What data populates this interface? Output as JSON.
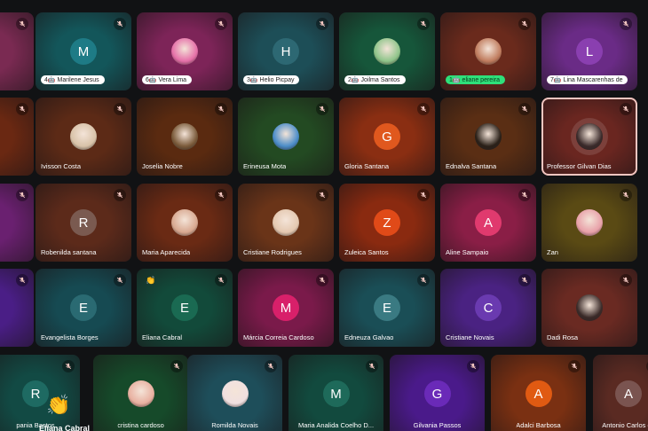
{
  "meeting": {
    "tiles": [
      {
        "name": "",
        "row": 0,
        "col": -1,
        "bg": "#7a2a52",
        "avatar": "none",
        "mic": "muted"
      },
      {
        "name": "",
        "pill": "4🤖 Marilene Jesus",
        "row": 0,
        "col": 0,
        "bg": "#13565a",
        "avatar": "M",
        "avatarColor": "#1e7b86",
        "mic": "muted"
      },
      {
        "name": "",
        "pill": "6🤖 Vera Lima",
        "row": 0,
        "col": 1,
        "bg": "#7d2458",
        "avatar": "photo",
        "avatarColor": "#e56fa8",
        "mic": "muted"
      },
      {
        "name": "",
        "pill": "3🤖 Helio Picpay",
        "row": 0,
        "col": 2,
        "bg": "#1d4e57",
        "avatar": "H",
        "avatarColor": "#2d6873",
        "mic": "muted"
      },
      {
        "name": "",
        "pill": "2🤖 Joilma Santos",
        "row": 0,
        "col": 3,
        "bg": "#16563a",
        "avatar": "photo",
        "avatarColor": "#8fc48a",
        "mic": "muted"
      },
      {
        "name": "",
        "pill": "1🤖 eliane pereira",
        "pillGreen": true,
        "row": 0,
        "col": 4,
        "bg": "#6a2a1c",
        "avatar": "photo",
        "avatarColor": "#c07c5e",
        "mic": "muted"
      },
      {
        "name": "",
        "pill": "7🤖 Lina Mascarenhas de",
        "row": 0,
        "col": 5,
        "bg": "#6a2b86",
        "avatar": "L",
        "avatarColor": "#8a3fb0",
        "mic": "muted"
      },
      {
        "name": "",
        "row": 1,
        "col": -1,
        "bg": "#6a2812",
        "avatar": "none",
        "mic": "muted"
      },
      {
        "name": "Ivisson Costa",
        "row": 1,
        "col": 0,
        "bg": "#5c2a16",
        "avatar": "photo",
        "avatarColor": "#d8c2a8",
        "mic": "muted"
      },
      {
        "name": "Joselia Nobre",
        "row": 1,
        "col": 1,
        "bg": "#5a2a10",
        "avatar": "photo",
        "avatarColor": "#7a5a3a",
        "mic": "muted"
      },
      {
        "name": "Erineusa Mota",
        "row": 1,
        "col": 2,
        "bg": "#234a22",
        "avatar": "photo",
        "avatarColor": "#4a8cc8",
        "mic": "muted"
      },
      {
        "name": "Gloria Santana",
        "row": 1,
        "col": 3,
        "bg": "#8a2e12",
        "avatar": "G",
        "avatarColor": "#e0581e",
        "mic": "muted"
      },
      {
        "name": "Ednalva Santana",
        "row": 1,
        "col": 4,
        "bg": "#5a2e14",
        "avatar": "photo",
        "avatarColor": "#2a2018",
        "mic": "muted"
      },
      {
        "name": "Professor Gilvan Dias",
        "row": 1,
        "col": 5,
        "bg": "#6a2620",
        "avatar": "photo",
        "avatarColor": "#3a2a2a",
        "mic": "muted",
        "active": true
      },
      {
        "name": "",
        "row": 2,
        "col": -1,
        "bg": "#6a2070",
        "avatar": "none",
        "mic": "muted"
      },
      {
        "name": "Robenilda santana",
        "row": 2,
        "col": 0,
        "bg": "#5c2a1a",
        "avatar": "R",
        "avatarColor": "#7a5a50",
        "mic": "muted"
      },
      {
        "name": "Maria Aparecida",
        "row": 2,
        "col": 1,
        "bg": "#6a2a14",
        "avatar": "photo",
        "avatarColor": "#d8a890",
        "mic": "muted"
      },
      {
        "name": "Cristiane Rodrigues",
        "row": 2,
        "col": 2,
        "bg": "#6a3418",
        "avatar": "photo",
        "avatarColor": "#e4c8b0",
        "mic": "muted"
      },
      {
        "name": "Zuleica Santos",
        "row": 2,
        "col": 3,
        "bg": "#8a2a10",
        "avatar": "Z",
        "avatarColor": "#e04a18",
        "mic": "muted"
      },
      {
        "name": "Aline Sampaio",
        "row": 2,
        "col": 4,
        "bg": "#8a1e46",
        "avatar": "A",
        "avatarColor": "#e03a6e",
        "mic": "muted"
      },
      {
        "name": "Zan",
        "row": 2,
        "col": 5,
        "bg": "#5a4a14",
        "avatar": "photo",
        "avatarColor": "#e8a0a8",
        "mic": "muted"
      },
      {
        "name": "",
        "row": 3,
        "col": -1,
        "bg": "#4a1e86",
        "avatar": "none",
        "mic": "muted"
      },
      {
        "name": "Evangelista Borges",
        "row": 3,
        "col": 0,
        "bg": "#164a52",
        "avatar": "E",
        "avatarColor": "#2a6a72",
        "mic": "muted"
      },
      {
        "name": "Eliana Cabral",
        "row": 3,
        "col": 1,
        "bg": "#124a3a",
        "avatar": "E",
        "avatarColor": "#1a6a52",
        "mic": "muted",
        "hand": true
      },
      {
        "name": "Márcia Correia Cardoso",
        "row": 3,
        "col": 2,
        "bg": "#7a1a4a",
        "avatar": "M",
        "avatarColor": "#d8206a",
        "mic": "muted"
      },
      {
        "name": "Edneuza Galvao",
        "row": 3,
        "col": 3,
        "bg": "#1a4e56",
        "avatar": "E",
        "avatarColor": "#3a7a82",
        "mic": "muted"
      },
      {
        "name": "Cristiane Novais",
        "row": 3,
        "col": 4,
        "bg": "#4a2282",
        "avatar": "C",
        "avatarColor": "#6a3ab0",
        "mic": "muted"
      },
      {
        "name": "Dadi Rosa",
        "row": 3,
        "col": 5,
        "bg": "#6a2a22",
        "avatar": "photo",
        "avatarColor": "#3a2a28",
        "mic": "muted"
      },
      {
        "name": "pania Bastos",
        "row": 4,
        "col": -1,
        "bg": "#124a44",
        "avatar": "R",
        "avatarColor": "#1e6a62",
        "mic": "muted",
        "bighand": true,
        "offsetRow": true
      },
      {
        "name": "cristina cardoso",
        "row": 4,
        "col": 0,
        "bg": "#164a2a",
        "avatar": "photo",
        "avatarColor": "#e8b0a0",
        "mic": "muted",
        "offsetRow": true
      },
      {
        "name": "Romilda Novais",
        "row": 4,
        "col": 1,
        "bg": "#1e4e5a",
        "avatar": "photo",
        "avatarColor": "#f0e0e0",
        "mic": "muted",
        "offsetRow": true
      },
      {
        "name": "Maria Analida Coelho D...",
        "row": 4,
        "col": 2,
        "bg": "#124a3e",
        "avatar": "M",
        "avatarColor": "#1e6a5a",
        "mic": "muted",
        "offsetRow": true
      },
      {
        "name": "Gilvania Passos",
        "row": 4,
        "col": 3,
        "bg": "#4a1a8a",
        "avatar": "G",
        "avatarColor": "#6a2ab8",
        "mic": "muted",
        "offsetRow": true
      },
      {
        "name": "Adalci Barbosa",
        "row": 4,
        "col": 4,
        "bg": "#7a3012",
        "avatar": "A",
        "avatarColor": "#e05a12",
        "mic": "muted",
        "offsetRow": true
      },
      {
        "name": "Antonio Carlos de",
        "row": 4,
        "col": 5,
        "bg": "#5a2a22",
        "avatar": "A",
        "avatarColor": "#7a5450",
        "mic": "muted",
        "offsetRow": true
      }
    ],
    "extra_label": "Eliana Cabral",
    "colors": {
      "muted_icon": "#f2c6c0",
      "name_text": "#ffffff",
      "active_border": "#f2c6c0"
    }
  }
}
